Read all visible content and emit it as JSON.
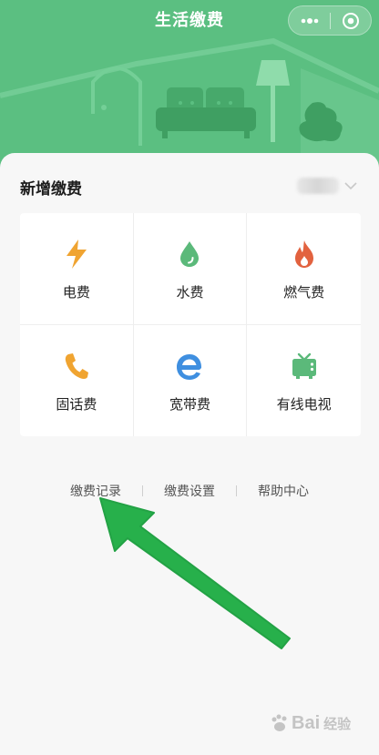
{
  "header": {
    "title": "生活缴费"
  },
  "capsule": {
    "more_icon": "more-dots-icon",
    "close_icon": "target-close-icon"
  },
  "section": {
    "title": "新增缴费"
  },
  "services": [
    {
      "label": "电费",
      "icon": "lightning-icon",
      "color": "#f0a431"
    },
    {
      "label": "水费",
      "icon": "water-drop-icon",
      "color": "#5bb97a"
    },
    {
      "label": "燃气费",
      "icon": "flame-icon",
      "color": "#e2623f"
    },
    {
      "label": "固话费",
      "icon": "phone-icon",
      "color": "#f0a431"
    },
    {
      "label": "宽带费",
      "icon": "broadband-e-icon",
      "color": "#3f8fe0"
    },
    {
      "label": "有线电视",
      "icon": "tv-icon",
      "color": "#5bb97a"
    }
  ],
  "footer_links": [
    {
      "label": "缴费记录"
    },
    {
      "label": "缴费设置"
    },
    {
      "label": "帮助中心"
    }
  ],
  "watermark": {
    "text": "Bai",
    "sub": "经验"
  },
  "colors": {
    "header_green": "#5bbf81",
    "arrow_green": "#27b04b",
    "background": "#f7f7f7"
  }
}
